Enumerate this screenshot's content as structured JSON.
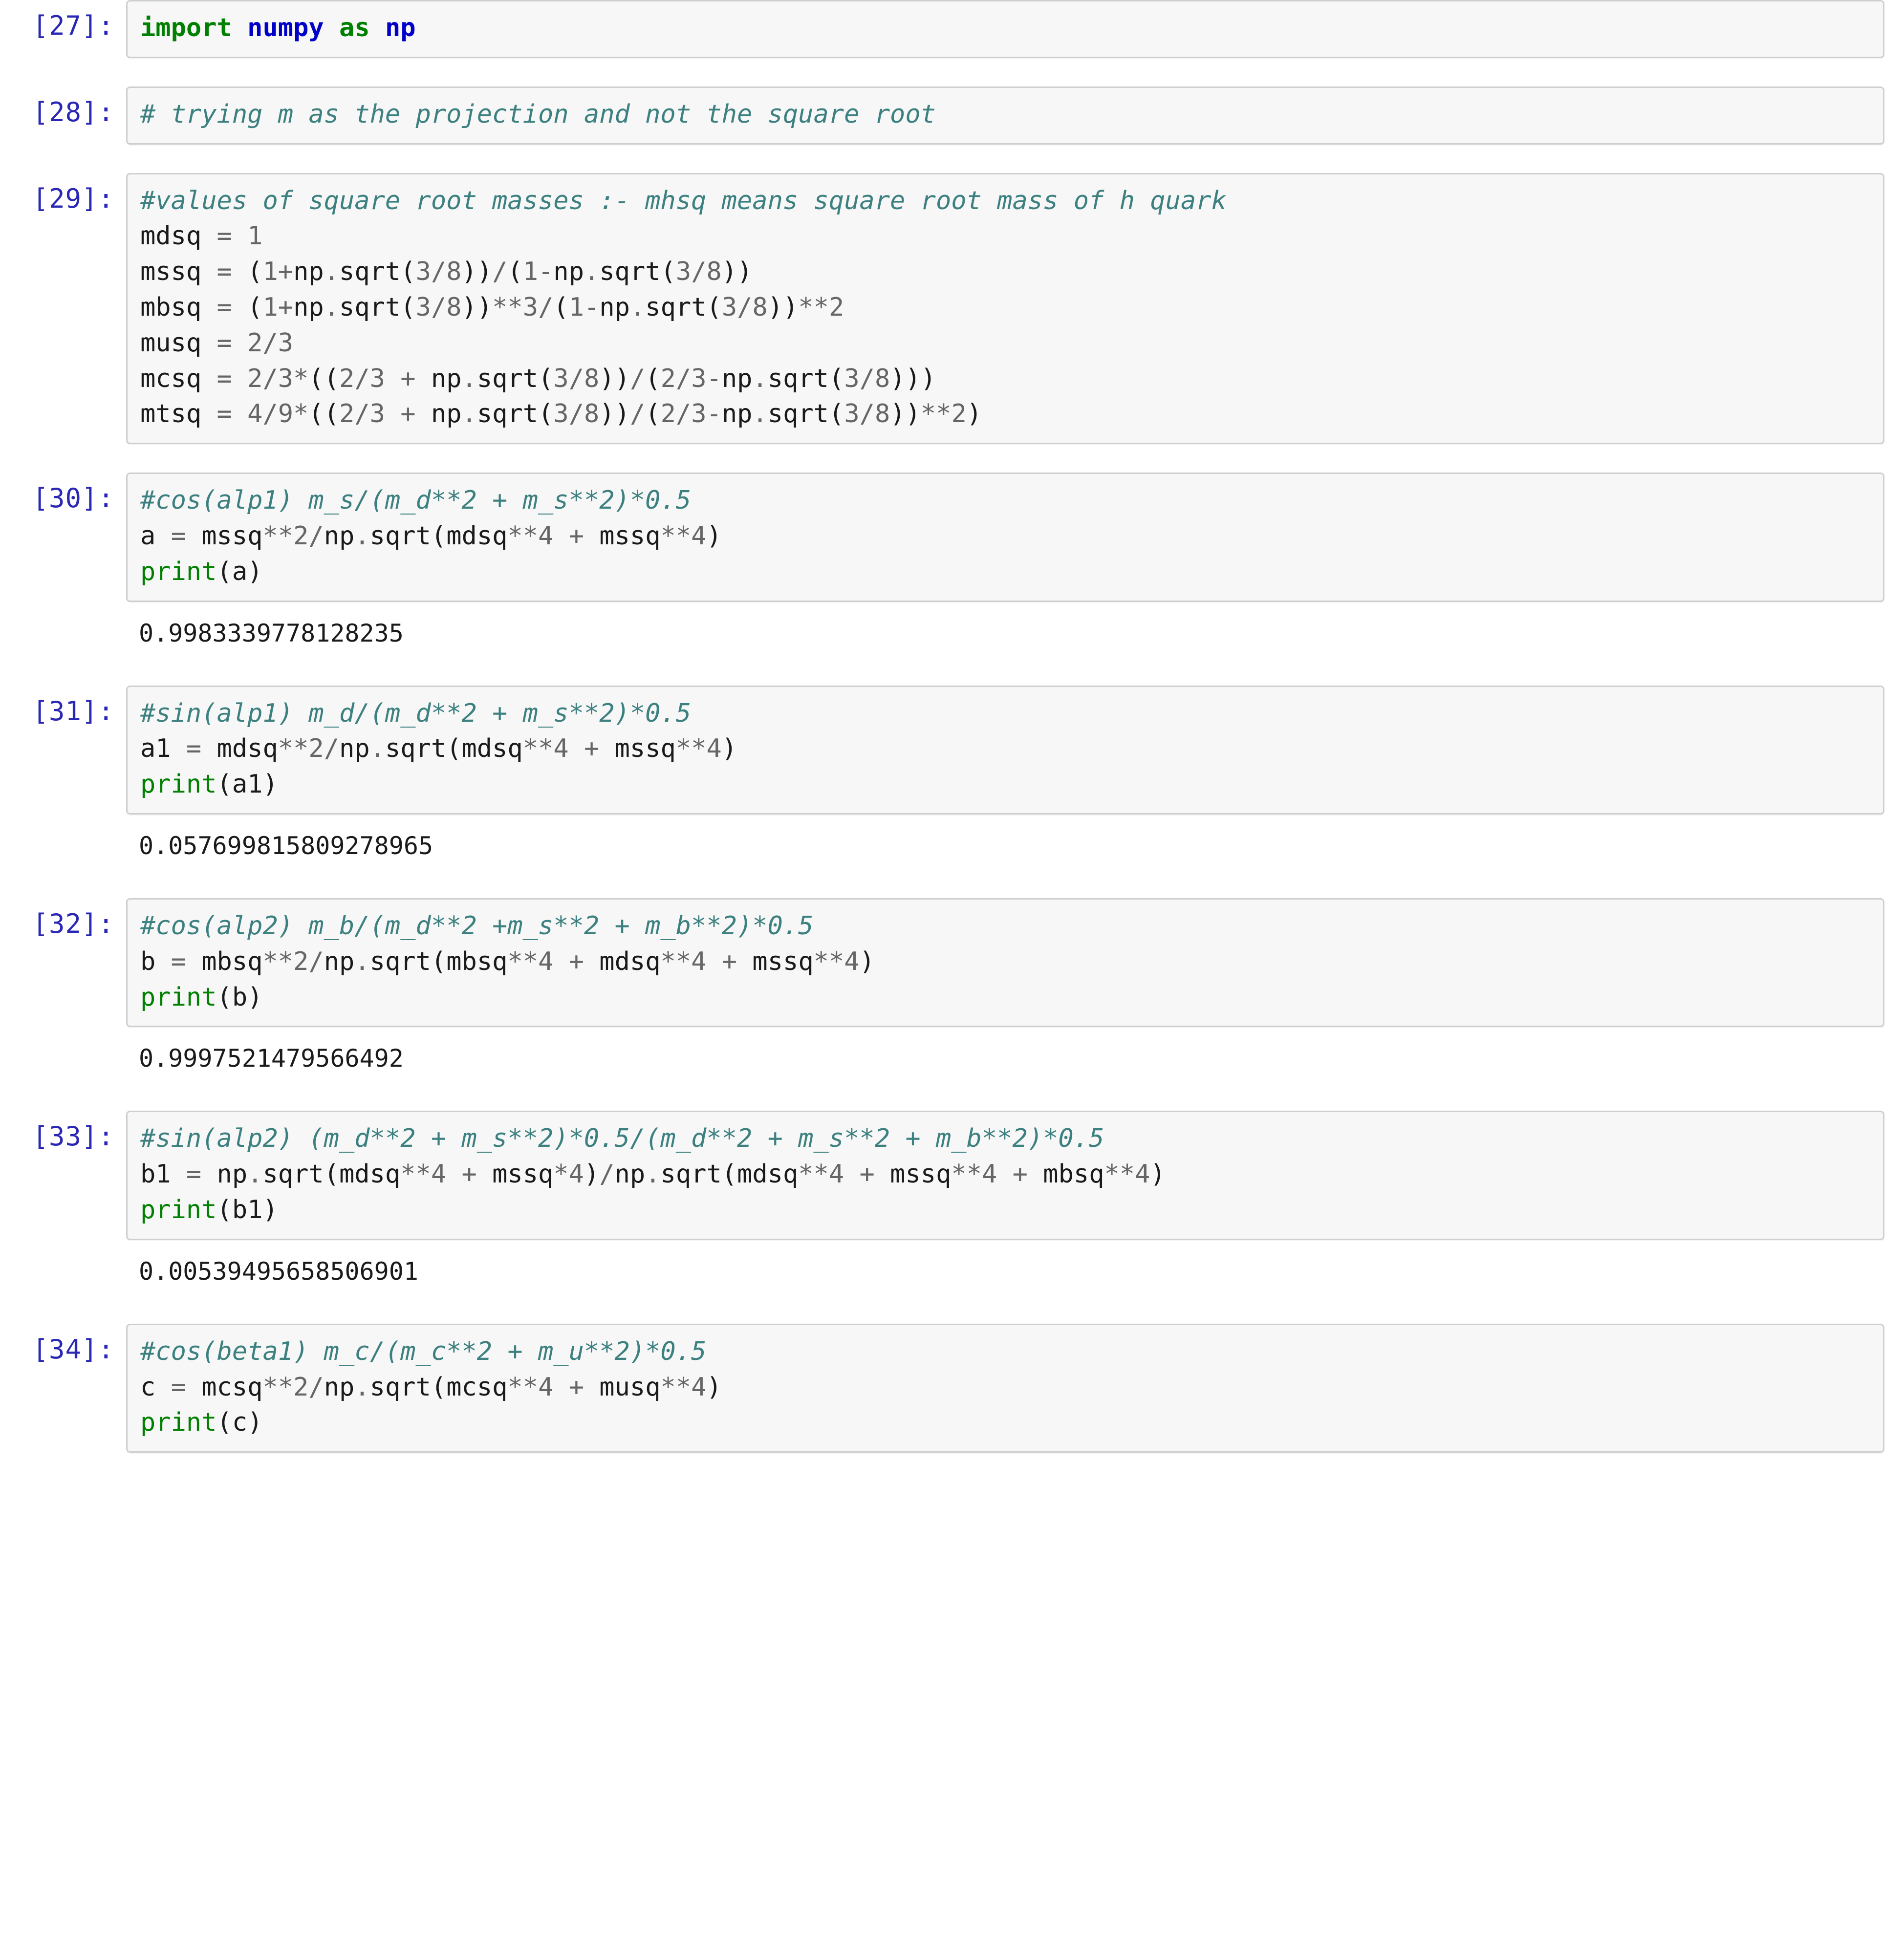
{
  "notebook": {
    "cells": [
      {
        "prompt": "[27]:",
        "source": "import numpy as np",
        "output": null
      },
      {
        "prompt": "[28]:",
        "source": "# trying m as the projection and not the square root",
        "output": null
      },
      {
        "prompt": "[29]:",
        "source": "#values of square root masses :- mhsq means square root mass of h quark\nmdsq = 1\nmssq = (1+np.sqrt(3/8))/(1-np.sqrt(3/8))\nmbsq = (1+np.sqrt(3/8))**3/(1-np.sqrt(3/8))**2\nmusq = 2/3\nmcsq = 2/3*((2/3 + np.sqrt(3/8))/(2/3-np.sqrt(3/8)))\nmtsq = 4/9*((2/3 + np.sqrt(3/8))/(2/3-np.sqrt(3/8))**2)",
        "output": null
      },
      {
        "prompt": "[30]:",
        "source": "#cos(alp1) m_s/(m_d**2 + m_s**2)*0.5\na = mssq**2/np.sqrt(mdsq**4 + mssq**4)\nprint(a)",
        "output": "0.9983339778128235"
      },
      {
        "prompt": "[31]:",
        "source": "#sin(alp1) m_d/(m_d**2 + m_s**2)*0.5\na1 = mdsq**2/np.sqrt(mdsq**4 + mssq**4)\nprint(a1)",
        "output": "0.057699815809278965"
      },
      {
        "prompt": "[32]:",
        "source": "#cos(alp2) m_b/(m_d**2 +m_s**2 + m_b**2)*0.5\nb = mbsq**2/np.sqrt(mbsq**4 + mdsq**4 + mssq**4)\nprint(b)",
        "output": "0.9997521479566492"
      },
      {
        "prompt": "[33]:",
        "source": "#sin(alp2) (m_d**2 + m_s**2)*0.5/(m_d**2 + m_s**2 + m_b**2)*0.5\nb1 = np.sqrt(mdsq**4 + mssq*4)/np.sqrt(mdsq**4 + mssq**4 + mbsq**4)\nprint(b1)",
        "output": "0.00539495658506901"
      },
      {
        "prompt": "[34]:",
        "source": "#cos(beta1) m_c/(m_c**2 + m_u**2)*0.5\nc = mcsq**2/np.sqrt(mcsq**4 + musq**4)\nprint(c)",
        "output": null
      }
    ]
  },
  "colors": {
    "prompt": "#2a27b5",
    "comment": "#3d8080",
    "keyword": "#008000",
    "module_name": "#0000c8",
    "builtin": "#008000",
    "cell_background": "#f7f7f7",
    "cell_border": "#cfcfcf",
    "page_background": "#ffffff",
    "text": "#1a1a1a"
  }
}
